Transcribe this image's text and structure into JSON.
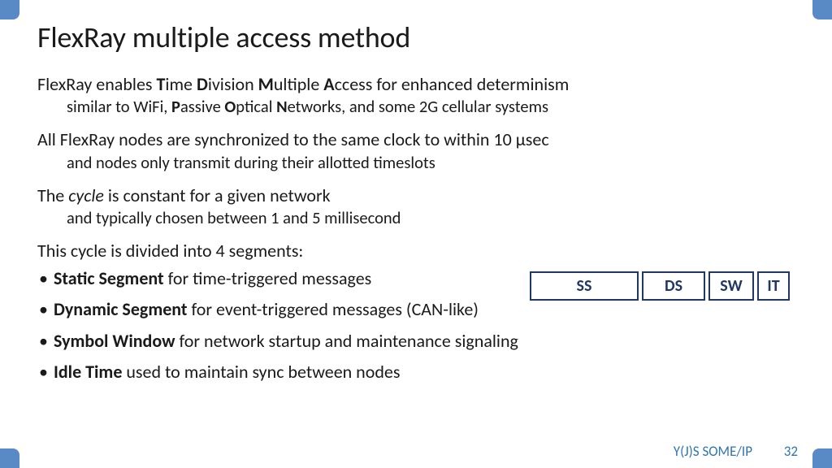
{
  "title": "FlexRay multiple access method",
  "para1": {
    "pre": "FlexRay enables ",
    "t": "T",
    "time": "ime ",
    "d": "D",
    "div": "ivision ",
    "m": "M",
    "mul": "ultiple ",
    "a": "A",
    "acc": "ccess for enhanced determinism",
    "sub_pre": "similar to WiFi, ",
    "p": "P",
    "pass": "assive ",
    "o": "O",
    "opt": "ptical ",
    "n": "N",
    "net": "etworks, and some 2G cellular systems"
  },
  "para2": {
    "main": "All FlexRay nodes are synchronized to the same clock to within 10 µsec",
    "sub": "and nodes only transmit during their allotted timeslots"
  },
  "para3": {
    "pre": "The ",
    "cycle": "cycle",
    "post": " is constant for a given network",
    "sub": "and typically chosen between 1 and 5 millisecond"
  },
  "para4": "This cycle is divided into 4 segments:",
  "bullets": [
    {
      "bold": "Static Segment",
      "rest": " for time-triggered messages"
    },
    {
      "bold": "Dynamic Segment",
      "rest": " for event-triggered messages (CAN-like)"
    },
    {
      "bold": "Symbol Window",
      "rest": " for network startup and maintenance signaling"
    },
    {
      "bold": "Idle Time",
      "rest": " used to maintain sync between nodes"
    }
  ],
  "diagram": {
    "ss": "SS",
    "ds": "DS",
    "sw": "SW",
    "it": "IT"
  },
  "footer": {
    "tag": "Y(J)S  SOME/IP",
    "page": "32"
  }
}
